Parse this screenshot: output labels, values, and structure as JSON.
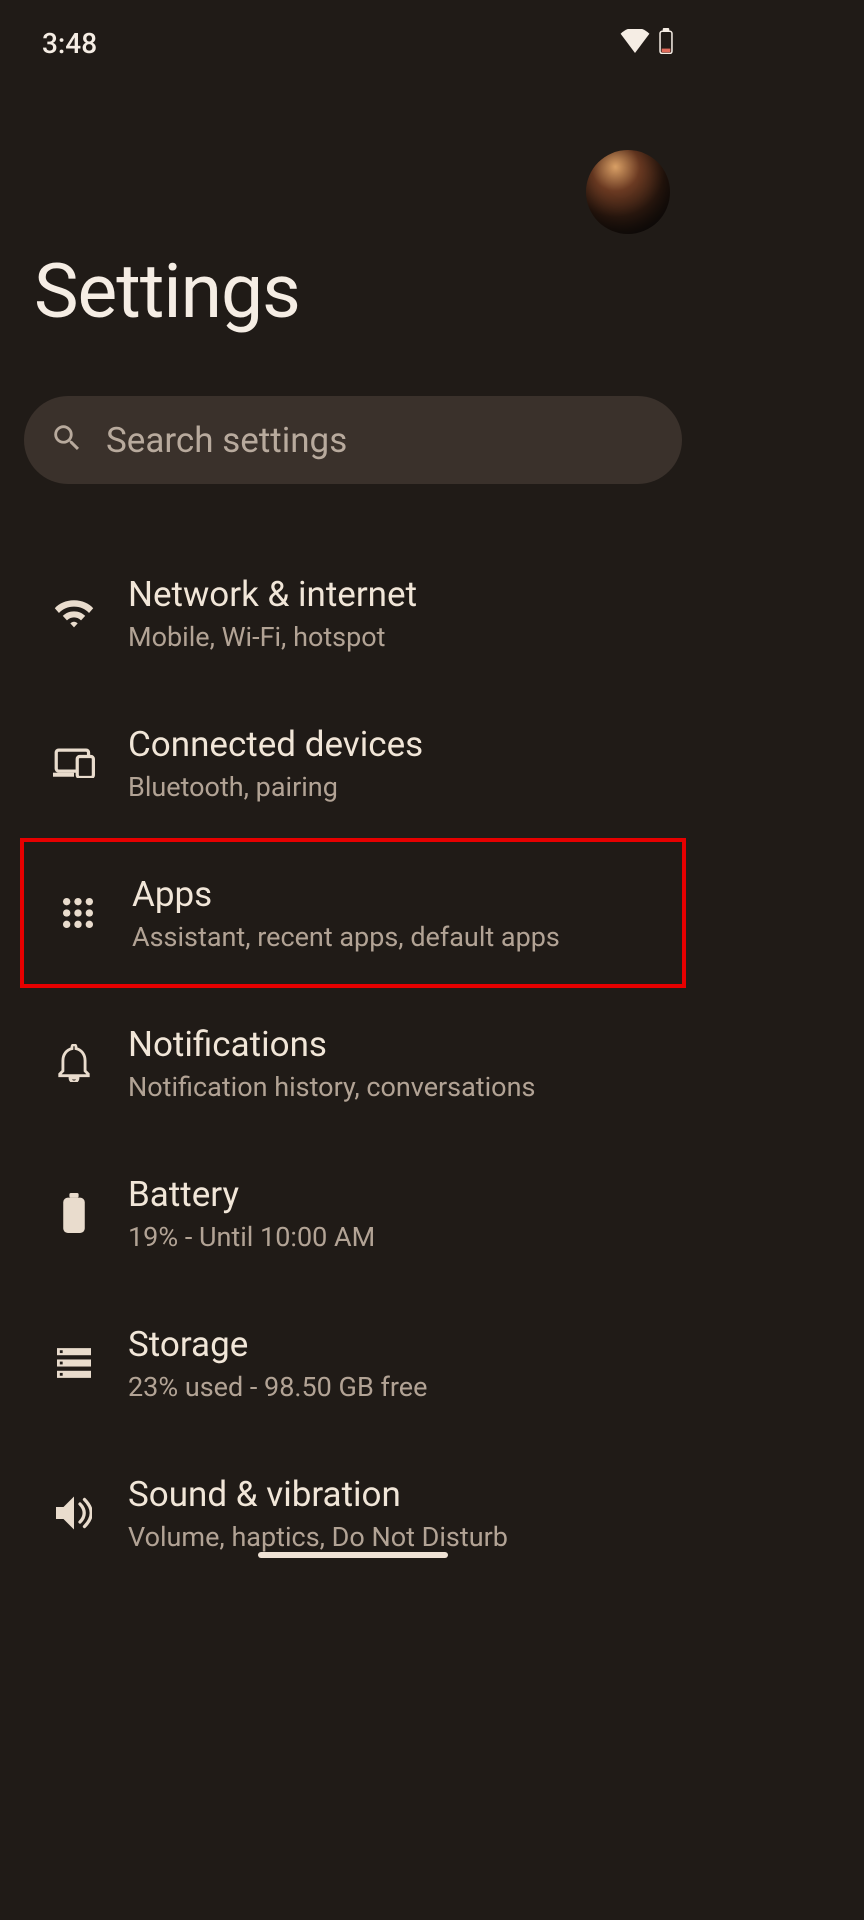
{
  "status": {
    "time": "3:48"
  },
  "header": {
    "title": "Settings"
  },
  "search": {
    "placeholder": "Search settings"
  },
  "items": [
    {
      "icon": "wifi",
      "title": "Network & internet",
      "subtitle": "Mobile, Wi-Fi, hotspot",
      "highlighted": false
    },
    {
      "icon": "devices",
      "title": "Connected devices",
      "subtitle": "Bluetooth, pairing",
      "highlighted": false
    },
    {
      "icon": "apps",
      "title": "Apps",
      "subtitle": "Assistant, recent apps, default apps",
      "highlighted": true
    },
    {
      "icon": "bell",
      "title": "Notifications",
      "subtitle": "Notification history, conversations",
      "highlighted": false
    },
    {
      "icon": "battery",
      "title": "Battery",
      "subtitle": "19% - Until 10:00 AM",
      "highlighted": false
    },
    {
      "icon": "storage",
      "title": "Storage",
      "subtitle": "23% used - 98.50 GB free",
      "highlighted": false
    },
    {
      "icon": "sound",
      "title": "Sound & vibration",
      "subtitle": "Volume, haptics, Do Not Disturb",
      "highlighted": false
    }
  ]
}
